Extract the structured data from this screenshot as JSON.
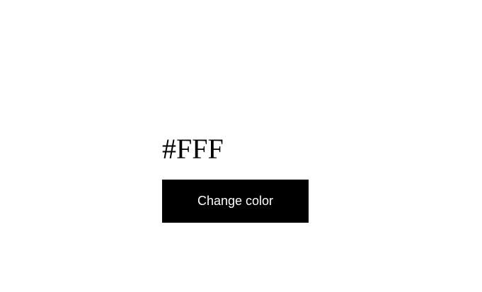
{
  "display": {
    "color_text": "#FFF",
    "background_color": "#FFFFFF"
  },
  "controls": {
    "change_button_label": "Change color",
    "button_color": "#000000",
    "button_text_color": "#FFFFFF"
  }
}
